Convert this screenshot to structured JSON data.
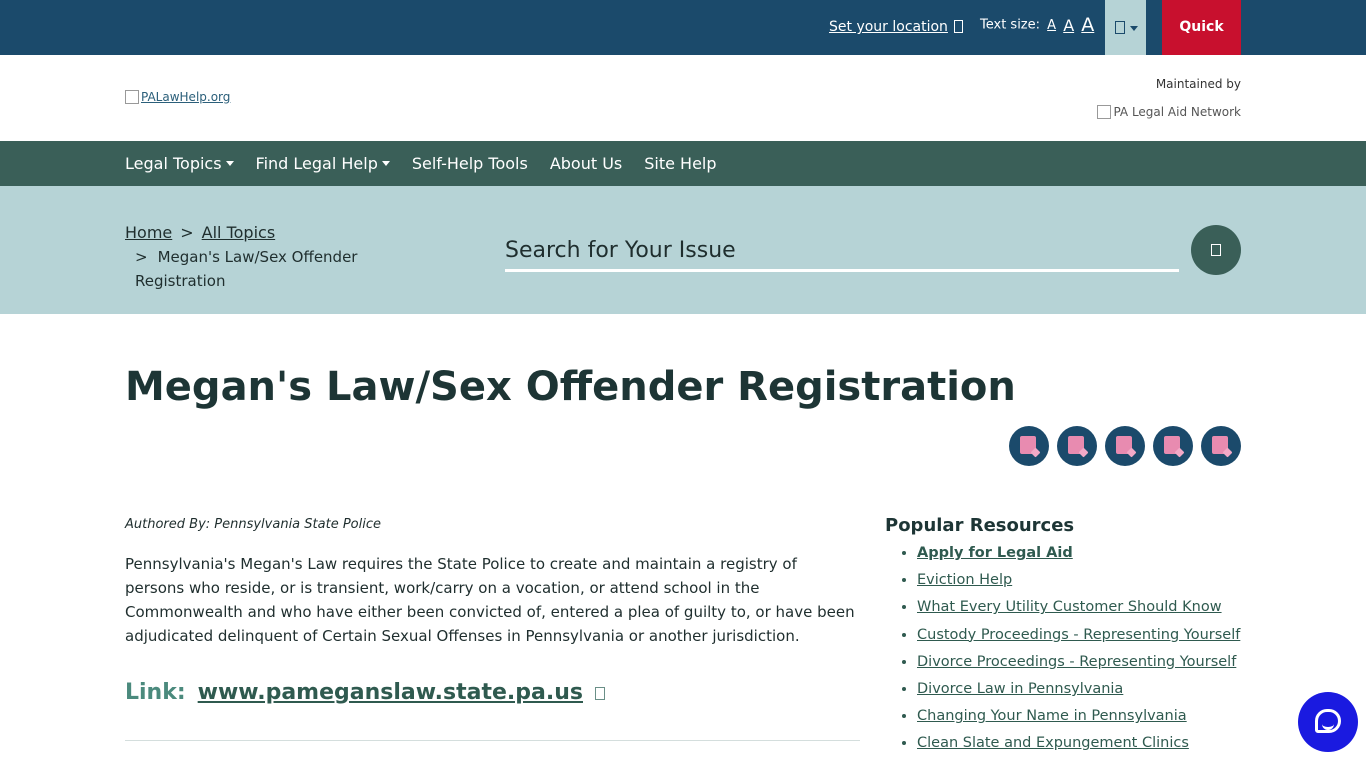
{
  "topbar": {
    "set_location": "Set your location",
    "text_size_label": "Text size:",
    "text_size_options": [
      "A",
      "A",
      "A"
    ],
    "quick_exit": "Quick Exit"
  },
  "header": {
    "logo_alt": "PALawHelp.org",
    "maintained_by": "Maintained by",
    "network_alt": "PA Legal Aid Network"
  },
  "nav": {
    "items": [
      "Legal Topics",
      "Find Legal Help",
      "Self-Help Tools",
      "About Us",
      "Site Help"
    ]
  },
  "breadcrumb": {
    "home": "Home",
    "separator": ">",
    "all_topics": "All Topics",
    "current": "Megan's Law/Sex Offender Registration"
  },
  "search": {
    "placeholder": "Search for Your Issue"
  },
  "page": {
    "title": "Megan's Law/Sex Offender Registration",
    "author": "Authored By: Pennsylvania State Police",
    "body": "Pennsylvania's Megan's Law requires the State Police to create and maintain a registry of persons who reside, or is transient, work/carry on a vocation, or attend school in the Commonwealth and who have either been convicted of, entered a plea of guilty to, or have been adjudicated delinquent of Certain Sexual Offenses in Pennsylvania or another jurisdiction.",
    "link_label": "Link:",
    "link_text": "www.pameganslaw.state.pa.us"
  },
  "popular": {
    "heading": "Popular Resources",
    "items": [
      "Apply for Legal Aid",
      "Eviction Help",
      "What Every Utility Customer Should Know",
      "Custody Proceedings - Representing Yourself",
      "Divorce Proceedings - Representing Yourself",
      "Divorce Law in Pennsylvania",
      "Changing Your Name in Pennsylvania",
      "Clean Slate and Expungement Clinics"
    ]
  },
  "colors": {
    "topbar": "#1b4a6b",
    "quick_exit": "#c8102e",
    "nav": "#3a5f58",
    "band": "#b6d3d6",
    "chat": "#1a1ae0"
  }
}
